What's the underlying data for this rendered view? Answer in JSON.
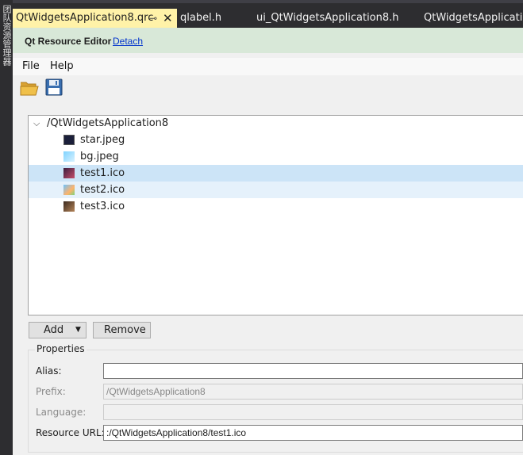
{
  "sidebar": {
    "label": "团队资源管理器"
  },
  "tabs": [
    {
      "label": "QtWidgetsApplication8.qrc",
      "active": true
    },
    {
      "label": "qlabel.h",
      "active": false
    },
    {
      "label": "ui_QtWidgetsApplication8.h",
      "active": false
    },
    {
      "label": "QtWidgetsApplication",
      "active": false
    }
  ],
  "header": {
    "title": "Qt Resource Editor",
    "link": "Detach"
  },
  "menu": [
    "File",
    "Help"
  ],
  "toolbar": [
    {
      "icon": "folder-open-icon"
    },
    {
      "icon": "save-icon"
    }
  ],
  "tree": {
    "root": "/QtWidgetsApplication8",
    "files": [
      {
        "name": "star.jpeg",
        "state": "normal"
      },
      {
        "name": "bg.jpeg",
        "state": "normal"
      },
      {
        "name": "test1.ico",
        "state": "selected"
      },
      {
        "name": "test2.ico",
        "state": "hover"
      },
      {
        "name": "test3.ico",
        "state": "normal"
      }
    ]
  },
  "buttons": {
    "add": "Add",
    "remove": "Remove"
  },
  "properties": {
    "title": "Properties",
    "alias": {
      "label": "Alias:",
      "value": ""
    },
    "prefix": {
      "label": "Prefix:",
      "value": "/QtWidgetsApplication8"
    },
    "language": {
      "label": "Language:",
      "value": ""
    },
    "resource_url": {
      "label": "Resource URL:",
      "value": ":/QtWidgetsApplication8/test1.ico"
    }
  }
}
